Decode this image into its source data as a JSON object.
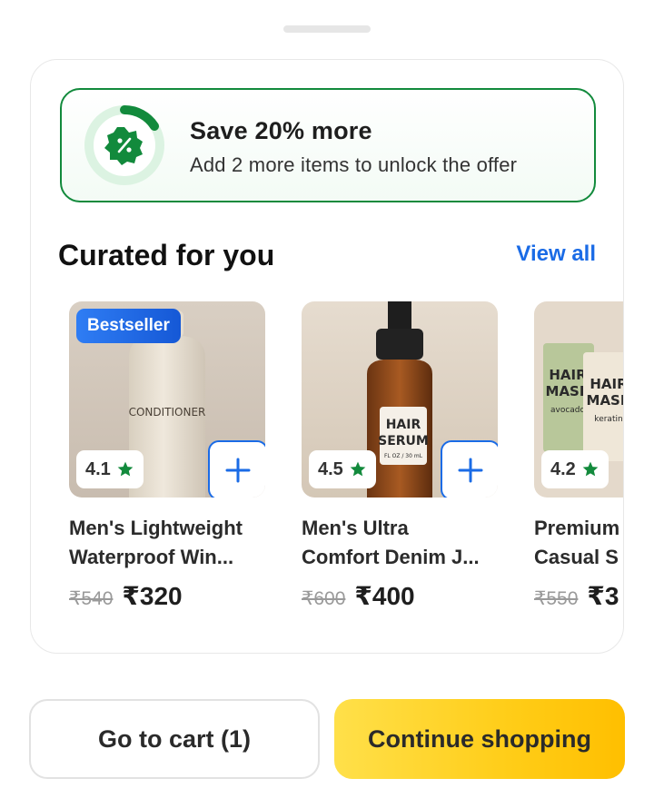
{
  "offer": {
    "title": "Save 20% more",
    "subtitle": "Add 2 more items to unlock the offer",
    "icon": "discount-badge-icon",
    "progress_fraction": 0.2,
    "accent_color": "#128a3c"
  },
  "section": {
    "title": "Curated for you",
    "view_all_label": "View all"
  },
  "products": [
    {
      "badge": "Bestseller",
      "rating": "4.1",
      "name": "Men's Lightweight",
      "name_line2": "Waterproof Win...",
      "mrp": "₹540",
      "price": "₹320",
      "image_text": "CONDITIONER"
    },
    {
      "badge": "",
      "rating": "4.5",
      "name": "Men's Ultra",
      "name_line2": "Comfort Denim J...",
      "mrp": "₹600",
      "price": "₹400",
      "image_text_1": "HAIR",
      "image_text_2": "SERUM",
      "image_text_3": "FL OZ / 30 mL"
    },
    {
      "badge": "",
      "rating": "4.2",
      "name": "Premium",
      "name_line2": "Casual S",
      "mrp": "₹550",
      "price": "₹3",
      "image_text_1": "HAIR",
      "image_text_2": "MASK",
      "image_text_3": "avocado",
      "image_text_4": "HAIR",
      "image_text_5": "MASK",
      "image_text_6": "keratin"
    }
  ],
  "actions": {
    "cart_label": "Go to cart (1)",
    "continue_label": "Continue shopping"
  },
  "colors": {
    "brand_blue": "#1a6be6",
    "rating_star": "#128a3c",
    "continue_yellow": "#ffcd18"
  }
}
